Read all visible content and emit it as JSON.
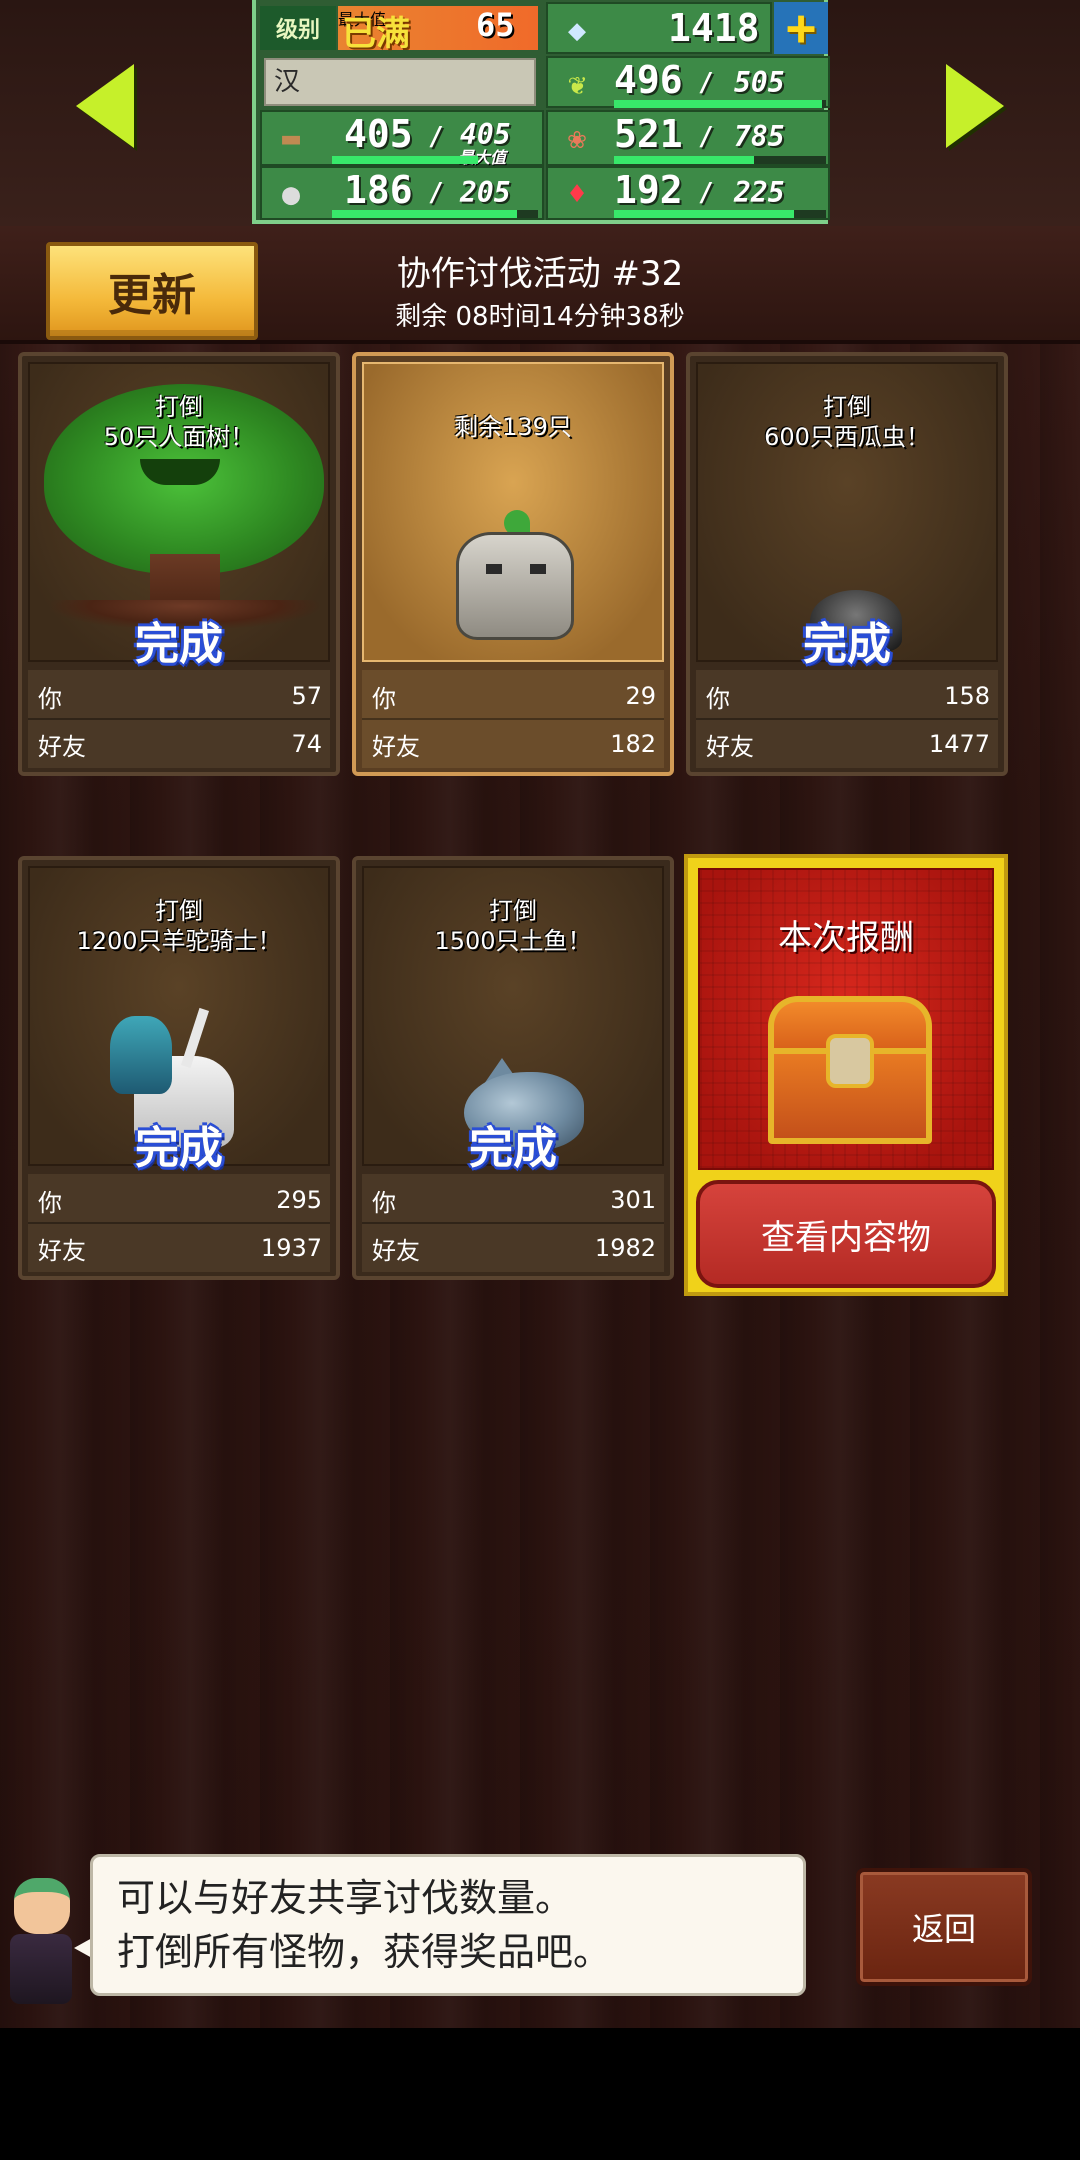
{
  "status": {
    "level_label": "级别",
    "level_state": "已满",
    "level_value": "65",
    "level_tag": "最大值",
    "gems": "1418",
    "name": "汉",
    "res_grass": {
      "value": "496",
      "max": "505",
      "fill": 0.98
    },
    "res_wood": {
      "value": "405",
      "max": "405",
      "tag": "最大值",
      "fill": 1.0
    },
    "res_food": {
      "value": "521",
      "max": "785",
      "fill": 0.66
    },
    "res_stone": {
      "value": "186",
      "max": "205",
      "fill": 0.9
    },
    "res_ruby": {
      "value": "192",
      "max": "225",
      "fill": 0.85
    }
  },
  "header": {
    "refresh_label": "更新",
    "title": "协作讨伐活动 #32",
    "timer": "剩余 08时间14分钟38秒"
  },
  "labels": {
    "you": "你",
    "friends": "好友",
    "complete": "完成"
  },
  "cards": [
    {
      "goal": "打倒\n50只人面树！",
      "you": "57",
      "friends": "74",
      "done": true,
      "monster": "tree"
    },
    {
      "goal": "剩余139只",
      "you": "29",
      "friends": "182",
      "done": false,
      "monster": "golem"
    },
    {
      "goal": "打倒\n600只西瓜虫！",
      "you": "158",
      "friends": "1477",
      "done": true,
      "monster": "bug"
    },
    {
      "goal": "打倒\n1200只羊驼骑士！",
      "you": "295",
      "friends": "1937",
      "done": true,
      "monster": "knight"
    },
    {
      "goal": "打倒\n1500只土鱼！",
      "you": "301",
      "friends": "1982",
      "done": true,
      "monster": "fish"
    }
  ],
  "reward": {
    "title": "本次报酬",
    "button": "查看内容物"
  },
  "dialog": {
    "line1": "可以与好友共享讨伐数量。",
    "line2": "打倒所有怪物，获得奖品吧。",
    "back_label": "返回"
  }
}
